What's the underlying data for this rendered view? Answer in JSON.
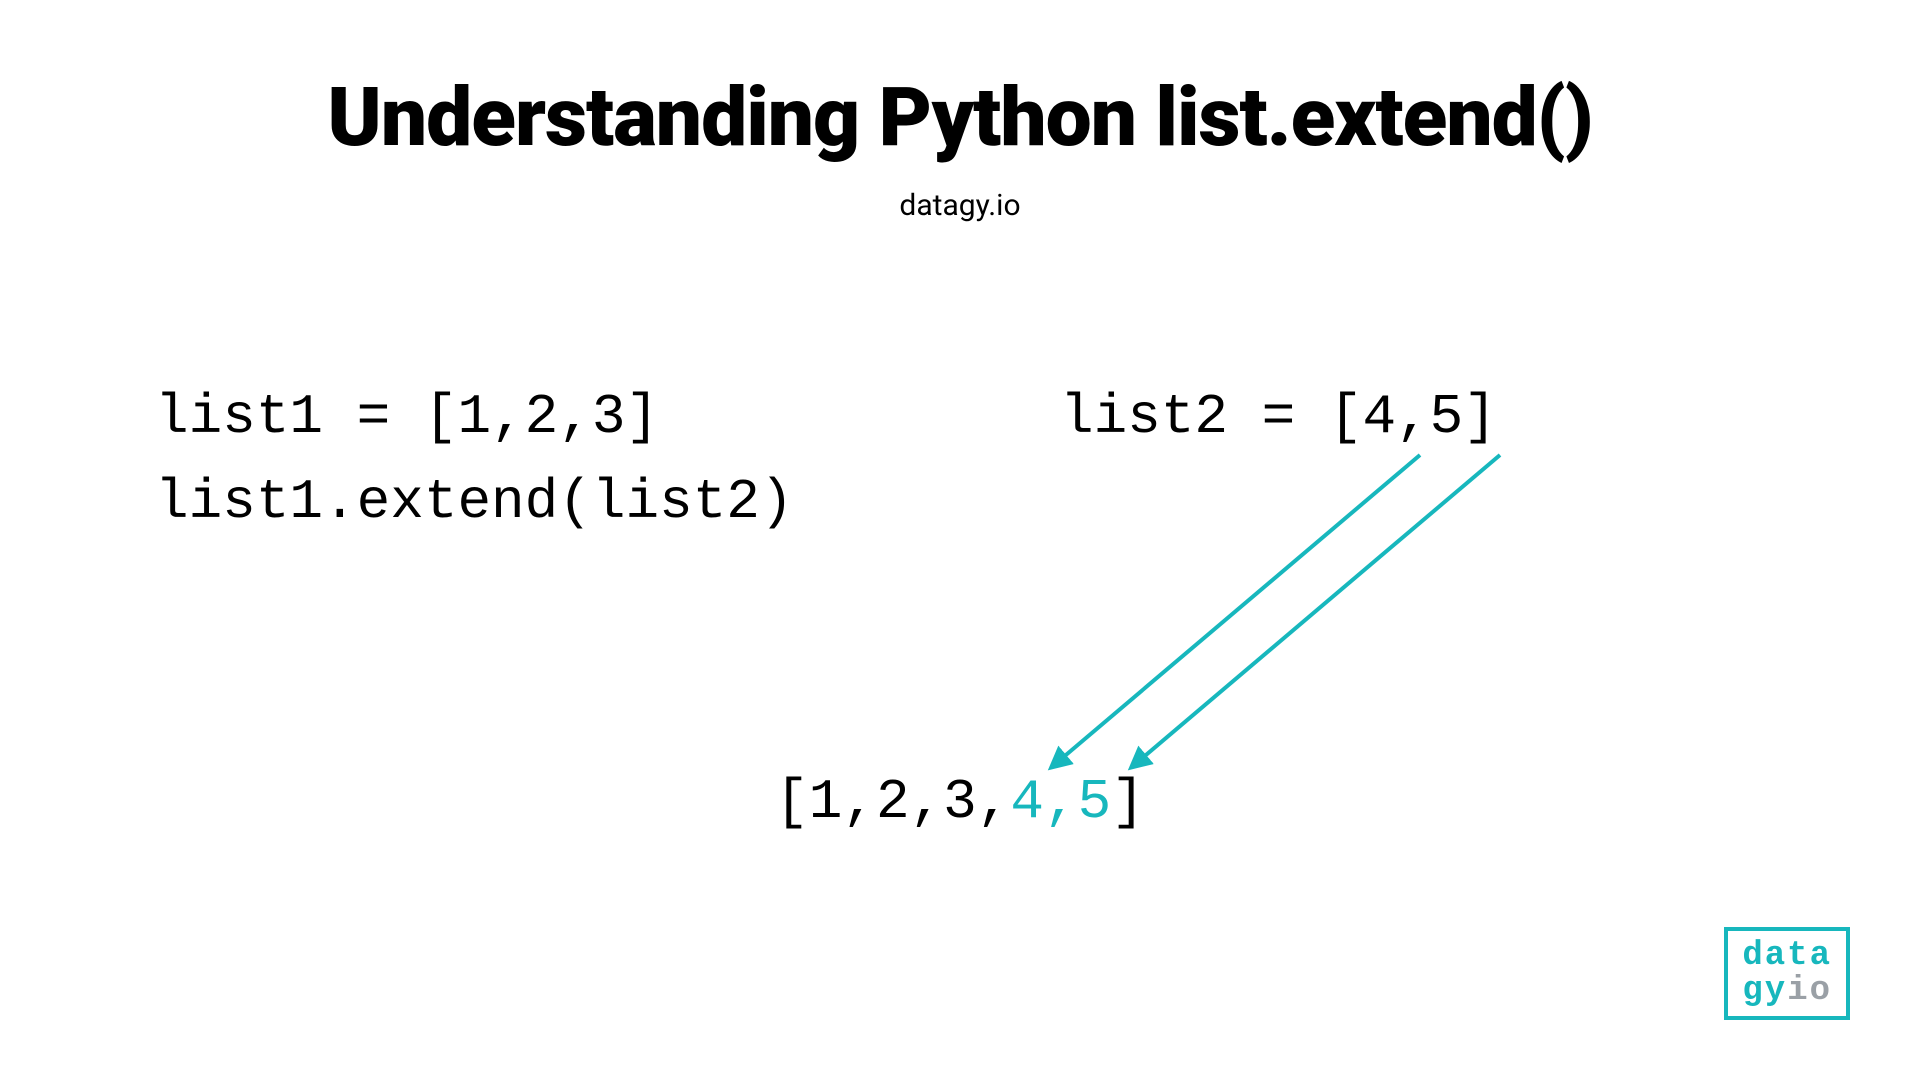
{
  "title": "Understanding Python list.extend()",
  "subtitle": "datagy.io",
  "code": {
    "list1": "list1 = [1,2,3]",
    "extend": "list1.extend(list2)",
    "list2": "list2 = [4,5]"
  },
  "result": {
    "prefix": "[1,2,3,",
    "highlight": "4,5",
    "suffix": "]"
  },
  "logo": {
    "line1": "data",
    "line2a": "gy",
    "line2b": "io"
  },
  "colors": {
    "teal": "#17b7bd",
    "grey": "#9aa0a6"
  }
}
